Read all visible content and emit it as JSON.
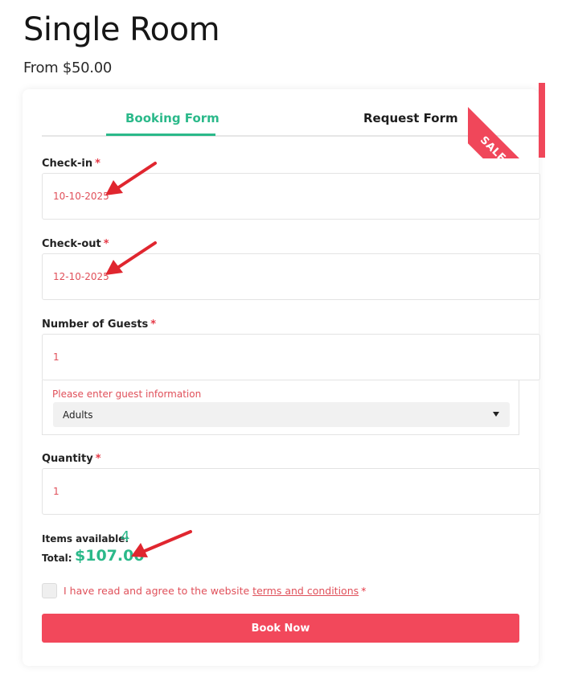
{
  "product": {
    "title": "Single Room",
    "price_from": "From $50.00"
  },
  "ribbon": {
    "label": "SALE",
    "icon": "gift-icon",
    "color": "#f0475a"
  },
  "tabs": [
    {
      "label": "Booking Form",
      "active": true
    },
    {
      "label": "Request Form",
      "active": false
    }
  ],
  "form": {
    "required_mark": "*",
    "checkin": {
      "label": "Check-in",
      "value": "10-10-2025"
    },
    "checkout": {
      "label": "Check-out",
      "value": "12-10-2025"
    },
    "guests": {
      "label": "Number of Guests",
      "value": "1",
      "hint": "Please enter guest information",
      "type_selected": "Adults"
    },
    "quantity": {
      "label": "Quantity",
      "value": "1"
    },
    "items_available": {
      "label": "Items available:",
      "value": "4"
    },
    "total": {
      "label": "Total:",
      "value": "$107.00"
    },
    "agree": {
      "text": "I have read and agree to the website",
      "link": "terms and conditions",
      "checked": false
    },
    "submit_label": "Book Now"
  },
  "colors": {
    "accent_green": "#2bb98a",
    "brand_red": "#f2485b",
    "annotation_arrow": "#e0262f"
  }
}
